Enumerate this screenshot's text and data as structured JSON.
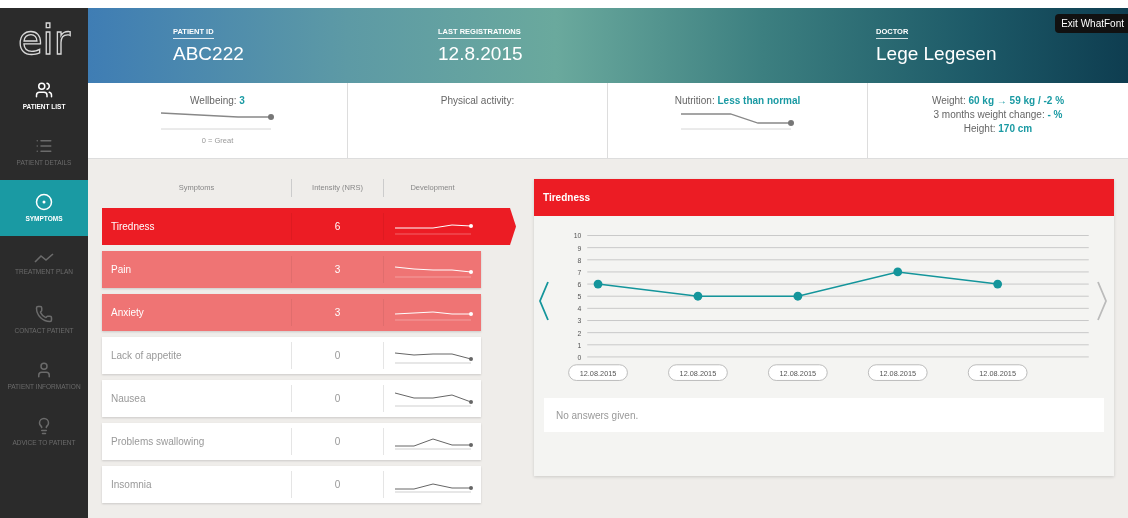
{
  "sidebar": {
    "logo": "eir",
    "items": [
      {
        "label": "PATIENT LIST",
        "selected": false,
        "disabled": false
      },
      {
        "label": "PATIENT DETAILS",
        "selected": false,
        "disabled": true
      },
      {
        "label": "SYMPTOMS",
        "selected": true,
        "disabled": false
      },
      {
        "label": "TREATMENT PLAN",
        "selected": false,
        "disabled": true
      },
      {
        "label": "CONTACT PATIENT",
        "selected": false,
        "disabled": true
      },
      {
        "label": "PATIENT INFORMATION",
        "selected": false,
        "disabled": true
      },
      {
        "label": "ADVICE TO PATIENT",
        "selected": false,
        "disabled": true
      }
    ]
  },
  "header": {
    "fields": [
      {
        "label": "PATIENT ID",
        "value": "ABC222"
      },
      {
        "label": "LAST REGISTRATIONS",
        "value": "12.8.2015"
      },
      {
        "label": "DOCTOR",
        "value": "Lege Legesen"
      }
    ],
    "exit_button": "Exit WhatFont"
  },
  "summary": [
    {
      "kind": "trend",
      "label": "Wellbeing:",
      "value": "3",
      "caption": "0 = Great"
    },
    {
      "kind": "text",
      "label": "Physical activity:"
    },
    {
      "kind": "trend",
      "label": "Nutrition:",
      "value": "Less than normal"
    },
    {
      "kind": "lines",
      "lines": [
        {
          "label": "Weight:",
          "value": "60 kg → 59 kg / -2 %"
        },
        {
          "label": "3 months weight change:",
          "value": "- %"
        },
        {
          "label": "Height:",
          "value": "170 cm"
        }
      ]
    }
  ],
  "symptoms": {
    "columns": [
      "Symptoms",
      "Intensity (NRS)",
      "Development"
    ],
    "rows": [
      {
        "name": "Tiredness",
        "intensity": "6",
        "kind": "severe",
        "selected": true
      },
      {
        "name": "Pain",
        "intensity": "3",
        "kind": "moderate",
        "selected": false
      },
      {
        "name": "Anxiety",
        "intensity": "3",
        "kind": "moderate",
        "selected": false
      },
      {
        "name": "Lack of appetite",
        "intensity": "0",
        "kind": "none",
        "selected": false
      },
      {
        "name": "Nausea",
        "intensity": "0",
        "kind": "none",
        "selected": false
      },
      {
        "name": "Problems swallowing",
        "intensity": "0",
        "kind": "none",
        "selected": false
      },
      {
        "name": "Insomnia",
        "intensity": "0",
        "kind": "none",
        "selected": false
      }
    ]
  },
  "detail": {
    "prev_disabled": false,
    "next_disabled": true,
    "chart_data": {
      "type": "line",
      "categories": [
        "12.08.2015",
        "12.08.2015",
        "12.08.2015",
        "12.08.2015",
        "12.08.2015"
      ],
      "series": [
        {
          "name": "Tiredness",
          "color": "#14959b",
          "values": [
            6,
            5,
            5,
            7,
            6
          ]
        }
      ],
      "ylim": [
        0,
        10
      ],
      "yticks": [
        0,
        1,
        2,
        3,
        4,
        5,
        6,
        7,
        8,
        9,
        10
      ],
      "grid": true,
      "marker": true
    },
    "note": "No answers given."
  }
}
